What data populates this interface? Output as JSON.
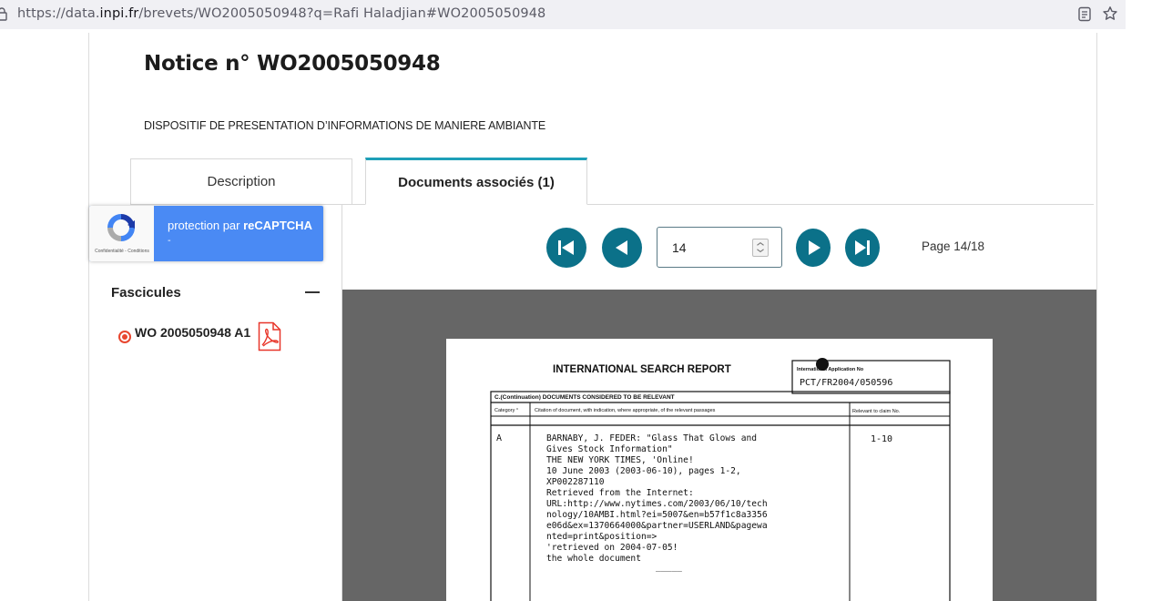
{
  "browser": {
    "url_prefix": "https://data.",
    "url_domain": "inpi.fr",
    "url_suffix": "/brevets/WO2005050948?q=Rafi Haladjian#WO2005050948",
    "icons": [
      "lock-icon",
      "reader-view-icon",
      "bookmark-star-icon"
    ]
  },
  "page": {
    "title": "Notice n° WO2005050948",
    "subtitle": "DISPOSITIF DE PRESENTATION D’INFORMATIONS DE MANIERE AMBIANTE"
  },
  "tabs": [
    {
      "label": "Description",
      "active": false
    },
    {
      "label": "Documents associés (1)",
      "active": true
    }
  ],
  "recaptcha": {
    "text_prefix": "protection par ",
    "text_brand": "reCAPTCHA",
    "dot": "-",
    "legal": "Confidentialité - Conditions"
  },
  "sidebar": {
    "title": "Fascicules",
    "items": [
      {
        "label": "WO 2005050948 A1",
        "selected": true,
        "icon": "pdf-icon"
      }
    ]
  },
  "pager": {
    "first_icon": "skip-first-icon",
    "prev_icon": "previous-icon",
    "next_icon": "next-icon",
    "last_icon": "skip-last-icon",
    "current": "14",
    "label": "Page 14/18"
  },
  "document": {
    "header": "INTERNATIONAL SEARCH REPORT",
    "app_no_label": "International Application No",
    "app_no": "PCT/FR2004/050596",
    "section": "C.(Continuation)  DOCUMENTS CONSIDERED TO BE RELEVANT",
    "col_category": "Category °",
    "col_citation": "Citation of document, with indication, where appropriate, of the relevant passages",
    "col_relevant": "Relevant to claim No.",
    "row_category": "A",
    "row_relevant": "1-10",
    "citation_lines": [
      "BARNABY, J. FEDER:  \"Glass That Glows and",
      "Gives Stock Information\"",
      "THE NEW YORK TIMES, 'Online!",
      "10 June 2003 (2003-06-10), pages 1-2,",
      "XP002287110",
      "Retrieved from the Internet:",
      "URL:http://www.nytimes.com/2003/06/10/tech",
      "nology/10AMBI.html?ei=5007&en=b57f1c8a3356",
      "e06d&ex=1370664000&partner=USERLAND&pagewa",
      "nted=print&position=>",
      "'retrieved on 2004-07-05!",
      "the whole document"
    ],
    "underline": "_____"
  }
}
